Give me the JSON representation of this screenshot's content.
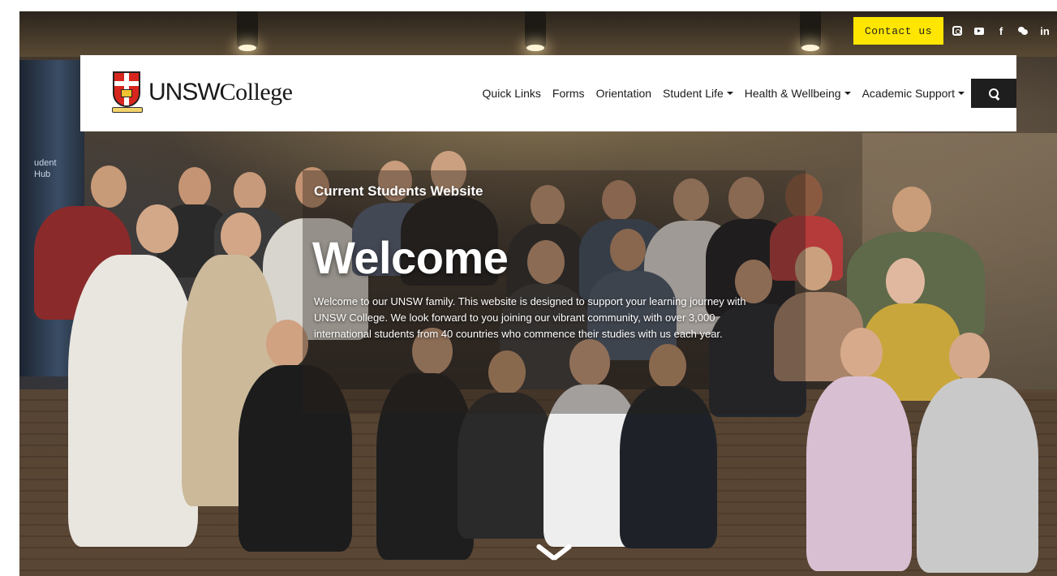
{
  "utility_bar": {
    "contact_label": "Contact us",
    "social": [
      {
        "icon": "instagram-icon"
      },
      {
        "icon": "youtube-icon"
      },
      {
        "icon": "facebook-icon",
        "glyph": "f"
      },
      {
        "icon": "wechat-icon"
      },
      {
        "icon": "linkedin-icon",
        "glyph": "in"
      }
    ],
    "contact_color": "#ffe600"
  },
  "header": {
    "logo_text_a": "UNSW",
    "logo_text_b": "College",
    "nav": [
      {
        "label": "Quick Links",
        "dropdown": false
      },
      {
        "label": "Forms",
        "dropdown": false
      },
      {
        "label": "Orientation",
        "dropdown": false
      },
      {
        "label": "Student Life",
        "dropdown": true
      },
      {
        "label": "Health & Wellbeing",
        "dropdown": true
      },
      {
        "label": "Academic Support",
        "dropdown": true
      }
    ],
    "search_icon": "search-icon"
  },
  "hero": {
    "kicker": "Current Students Website",
    "headline": "Welcome",
    "intro_lines": [
      "Welcome to our UNSW family. This website is designed to support your learning journey with",
      "UNSW College. We look forward to you joining our vibrant community, with over 3,000",
      "international students from 40 countries who commence their studies with us each year."
    ],
    "background_sign": [
      "udent",
      "Hub"
    ],
    "scroll_icon": "chevron-down-icon"
  }
}
